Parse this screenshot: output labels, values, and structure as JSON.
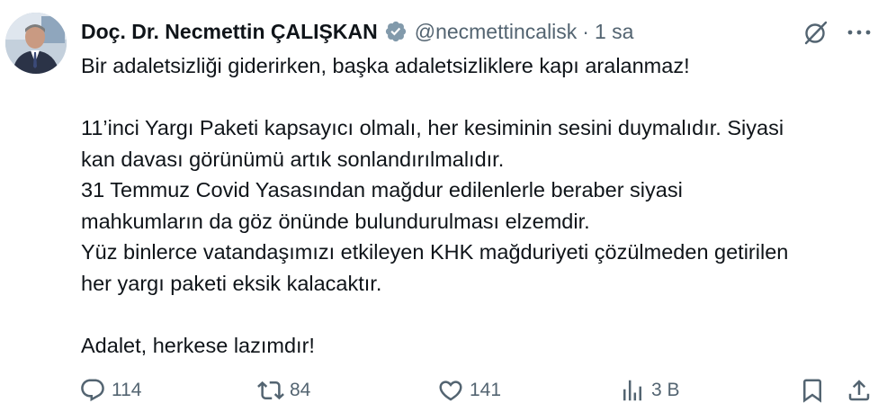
{
  "author": {
    "name": "Doç. Dr. Necmettin ÇALIŞKAN",
    "handle": "@necmettincalisk",
    "separator": "·",
    "time": "1 sa",
    "verified_color": "#829aab"
  },
  "post": {
    "lines": [
      "Bir adaletsizliği giderirken, başka adaletsizliklere kapı aralanmaz!",
      "",
      "11’inci Yargı Paketi kapsayıcı olmalı, her kesiminin sesini duymalıdır. Siyasi",
      "kan davası görünümü artık sonlandırılmalıdır.",
      "31 Temmuz Covid Yasasından mağdur edilenlerle beraber siyasi",
      "mahkumların da göz önünde bulundurulması elzemdir.",
      "Yüz binlerce vatandaşımızı etkileyen KHK mağduriyeti çözülmeden getirilen",
      "her yargı paketi eksik kalacaktır.",
      "",
      "Adalet, herkese lazımdır!"
    ]
  },
  "actions": {
    "replies": "114",
    "reposts": "84",
    "likes": "141",
    "views": "3 B"
  },
  "icons": [
    "avatar",
    "verified-badge-icon",
    "grok-icon",
    "more-icon",
    "reply-icon",
    "repost-icon",
    "like-icon",
    "views-icon",
    "bookmark-icon",
    "share-icon"
  ]
}
